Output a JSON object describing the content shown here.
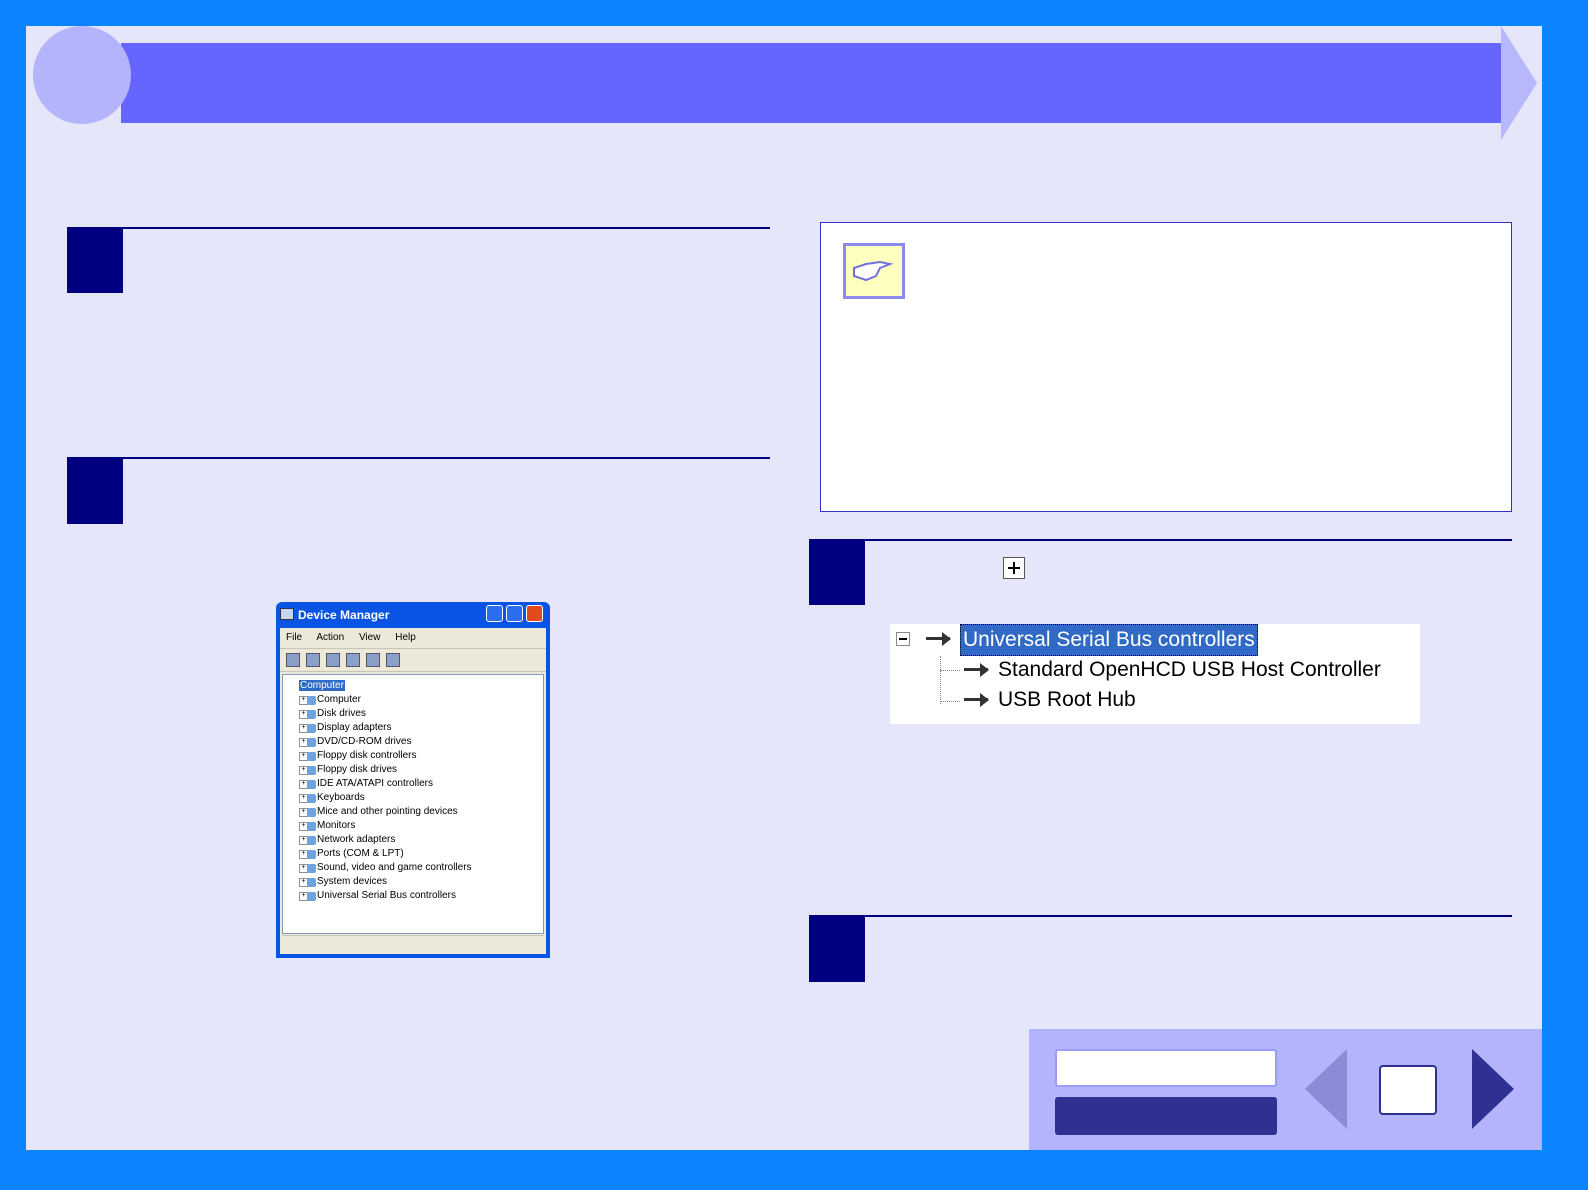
{
  "header": {
    "title": ""
  },
  "steps": [
    {
      "number": "",
      "text": ""
    },
    {
      "number": "",
      "text": ""
    },
    {
      "number": "",
      "text": ""
    },
    {
      "number": "",
      "text": ""
    }
  ],
  "device_manager": {
    "title": "Device Manager",
    "menu": [
      "File",
      "Action",
      "View",
      "Help"
    ],
    "root": "Computer",
    "items": [
      "Computer",
      "Disk drives",
      "Display adapters",
      "DVD/CD-ROM drives",
      "Floppy disk controllers",
      "Floppy disk drives",
      "IDE ATA/ATAPI controllers",
      "Keyboards",
      "Mice and other pointing devices",
      "Monitors",
      "Network adapters",
      "Ports (COM & LPT)",
      "Sound, video and game controllers",
      "System devices",
      "Universal Serial Bus controllers"
    ]
  },
  "usb_tree": {
    "root": "Universal Serial Bus controllers",
    "children": [
      "Standard OpenHCD USB Host Controller",
      "USB Root Hub"
    ]
  },
  "nav": {
    "button1": "",
    "button2": "",
    "page": ""
  },
  "colors": {
    "background": "#0a84ff",
    "page": "#e6e6fa",
    "title_bar": "#6666ff",
    "step_box": "#000080"
  }
}
